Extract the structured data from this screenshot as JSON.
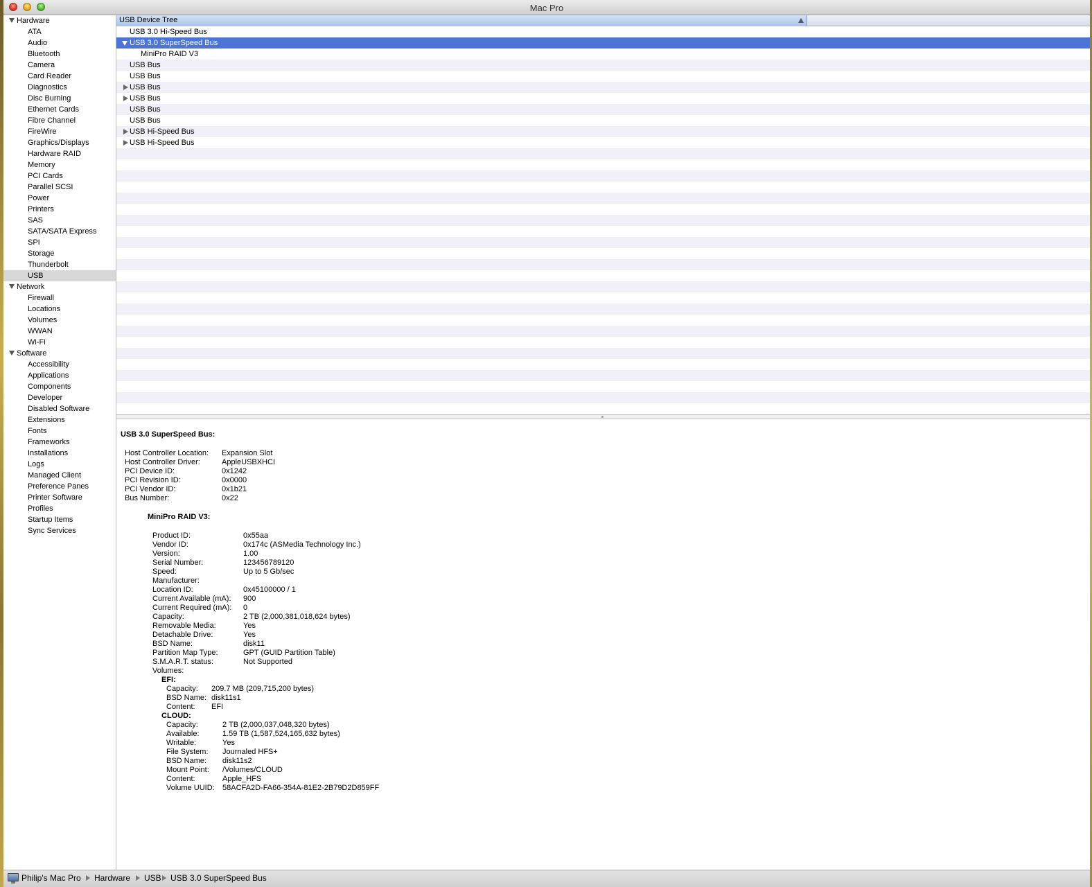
{
  "window": {
    "title": "Mac Pro"
  },
  "sidebar": {
    "groups": [
      {
        "label": "Hardware",
        "items": [
          "ATA",
          "Audio",
          "Bluetooth",
          "Camera",
          "Card Reader",
          "Diagnostics",
          "Disc Burning",
          "Ethernet Cards",
          "Fibre Channel",
          "FireWire",
          "Graphics/Displays",
          "Hardware RAID",
          "Memory",
          "PCI Cards",
          "Parallel SCSI",
          "Power",
          "Printers",
          "SAS",
          "SATA/SATA Express",
          "SPI",
          "Storage",
          "Thunderbolt",
          "USB"
        ]
      },
      {
        "label": "Network",
        "items": [
          "Firewall",
          "Locations",
          "Volumes",
          "WWAN",
          "Wi-Fi"
        ]
      },
      {
        "label": "Software",
        "items": [
          "Accessibility",
          "Applications",
          "Components",
          "Developer",
          "Disabled Software",
          "Extensions",
          "Fonts",
          "Frameworks",
          "Installations",
          "Logs",
          "Managed Client",
          "Preference Panes",
          "Printer Software",
          "Profiles",
          "Startup Items",
          "Sync Services"
        ]
      }
    ],
    "selected": "USB"
  },
  "tree": {
    "header": "USB Device Tree",
    "rows": [
      {
        "label": "USB 3.0 Hi-Speed Bus",
        "level": 0,
        "expander": "none"
      },
      {
        "label": "USB 3.0 SuperSpeed Bus",
        "level": 0,
        "expander": "open",
        "selected": true
      },
      {
        "label": "MiniPro RAID V3",
        "level": 1,
        "expander": "none"
      },
      {
        "label": "USB Bus",
        "level": 0,
        "expander": "none"
      },
      {
        "label": "USB Bus",
        "level": 0,
        "expander": "none"
      },
      {
        "label": "USB Bus",
        "level": 0,
        "expander": "closed"
      },
      {
        "label": "USB Bus",
        "level": 0,
        "expander": "closed"
      },
      {
        "label": "USB Bus",
        "level": 0,
        "expander": "none"
      },
      {
        "label": "USB Bus",
        "level": 0,
        "expander": "none"
      },
      {
        "label": "USB Hi-Speed Bus",
        "level": 0,
        "expander": "closed"
      },
      {
        "label": "USB Hi-Speed Bus",
        "level": 0,
        "expander": "closed"
      }
    ]
  },
  "detail": {
    "title": "USB 3.0 SuperSpeed Bus:",
    "bus_props": [
      [
        "Host Controller Location:",
        "Expansion Slot"
      ],
      [
        "Host Controller Driver:",
        "AppleUSBXHCI"
      ],
      [
        "PCI Device ID:",
        "0x1242"
      ],
      [
        "PCI Revision ID:",
        "0x0000"
      ],
      [
        "PCI Vendor ID:",
        "0x1b21"
      ],
      [
        "Bus Number:",
        "0x22"
      ]
    ],
    "device_title": "MiniPro RAID V3:",
    "device_props": [
      [
        "Product ID:",
        "0x55aa"
      ],
      [
        "Vendor ID:",
        "0x174c  (ASMedia Technology Inc.)"
      ],
      [
        "Version:",
        " 1.00"
      ],
      [
        "Serial Number:",
        "123456789120"
      ],
      [
        "Speed:",
        "Up to 5 Gb/sec"
      ],
      [
        "Manufacturer:",
        ""
      ],
      [
        "Location ID:",
        "0x45100000 / 1"
      ],
      [
        "Current Available (mA):",
        "900"
      ],
      [
        "Current Required (mA):",
        "0"
      ],
      [
        "Capacity:",
        "2 TB (2,000,381,018,624 bytes)"
      ],
      [
        "Removable Media:",
        "Yes"
      ],
      [
        "Detachable Drive:",
        "Yes"
      ],
      [
        "BSD Name:",
        "disk11"
      ],
      [
        "Partition Map Type:",
        "GPT (GUID Partition Table)"
      ],
      [
        "S.M.A.R.T. status:",
        "Not Supported"
      ],
      [
        "Volumes:",
        ""
      ]
    ],
    "volumes": [
      {
        "name": "EFI:",
        "props": [
          [
            "Capacity:",
            "209.7 MB (209,715,200 bytes)"
          ],
          [
            "BSD Name:",
            "disk11s1"
          ],
          [
            "Content:",
            "EFI"
          ]
        ]
      },
      {
        "name": "CLOUD:",
        "props": [
          [
            "Capacity:",
            "2 TB (2,000,037,048,320 bytes)"
          ],
          [
            "Available:",
            "1.59 TB (1,587,524,165,632 bytes)"
          ],
          [
            "Writable:",
            "Yes"
          ],
          [
            "File System:",
            "Journaled HFS+"
          ],
          [
            "BSD Name:",
            "disk11s2"
          ],
          [
            "Mount Point:",
            "/Volumes/CLOUD"
          ],
          [
            "Content:",
            "Apple_HFS"
          ],
          [
            "Volume UUID:",
            "58ACFA2D-FA66-354A-81E2-2B79D2D859FF"
          ]
        ]
      }
    ]
  },
  "statusbar": {
    "icon": "computer-icon",
    "crumbs": [
      "Philip's Mac Pro",
      "Hardware",
      "USB",
      "USB 3.0 SuperSpeed Bus"
    ]
  }
}
